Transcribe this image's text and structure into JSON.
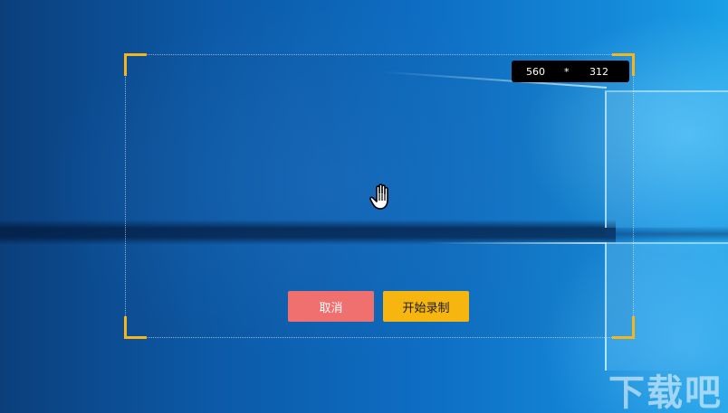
{
  "selection": {
    "width_label": "560",
    "separator": "*",
    "height_label": "312",
    "frame_color": "#f6b61a"
  },
  "actions": {
    "cancel_label": "取消",
    "cancel_color": "#f07070",
    "start_label": "开始录制",
    "start_color": "#f6b60f"
  },
  "cursor": {
    "icon": "hand-cursor-icon"
  },
  "watermark": {
    "text": "下载吧"
  }
}
